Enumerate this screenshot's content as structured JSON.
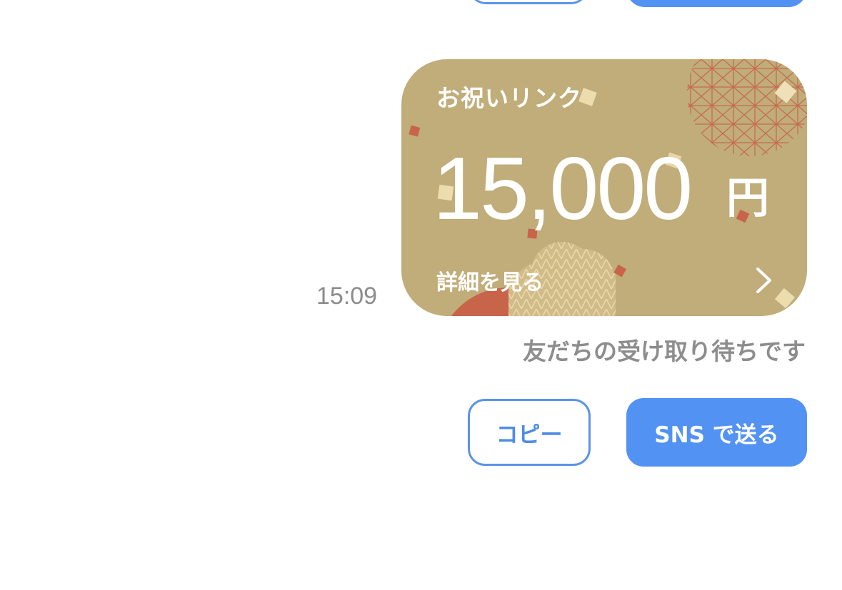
{
  "previous_message": {
    "copy_button_partial": true,
    "sns_button_partial": true
  },
  "gift_card": {
    "title": "お祝いリンク",
    "amount": "15,000",
    "currency": "円",
    "details_label": "詳細を見る",
    "chevron_icon": "chevron-right-icon",
    "background_color": "#c0ad79",
    "accent_color": "#c8644a"
  },
  "message": {
    "timestamp": "15:09",
    "status": "友だちの受け取り待ちです"
  },
  "actions": {
    "copy_label": "コピー",
    "sns_label": "SNS で送る",
    "primary_color": "#5292f3"
  }
}
